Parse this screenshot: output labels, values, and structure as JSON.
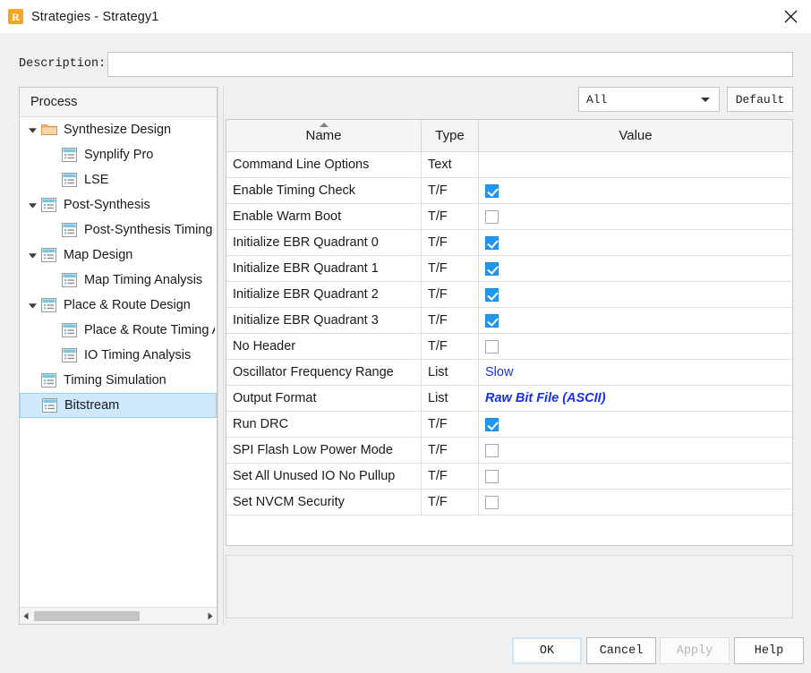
{
  "window": {
    "title": "Strategies - Strategy1",
    "icon": "app-r-icon",
    "close_icon": "close-icon"
  },
  "description": {
    "label": "Description:",
    "value": "",
    "placeholder": ""
  },
  "tree": {
    "header": "Process",
    "items": [
      {
        "label": "Synthesize Design",
        "indent": 0,
        "twisty": "expanded",
        "icon": "folder-icon",
        "selected": false
      },
      {
        "label": "Synplify Pro",
        "indent": 1,
        "twisty": "none",
        "icon": "document-icon",
        "selected": false
      },
      {
        "label": "LSE",
        "indent": 1,
        "twisty": "none",
        "icon": "document-icon",
        "selected": false
      },
      {
        "label": "Post-Synthesis",
        "indent": 0,
        "twisty": "expanded",
        "icon": "document-icon",
        "selected": false
      },
      {
        "label": "Post-Synthesis Timing Analysis",
        "indent": 1,
        "twisty": "none",
        "icon": "document-icon",
        "selected": false
      },
      {
        "label": "Map Design",
        "indent": 0,
        "twisty": "expanded",
        "icon": "document-icon",
        "selected": false
      },
      {
        "label": "Map Timing Analysis",
        "indent": 1,
        "twisty": "none",
        "icon": "document-icon",
        "selected": false
      },
      {
        "label": "Place & Route Design",
        "indent": 0,
        "twisty": "expanded",
        "icon": "document-icon",
        "selected": false
      },
      {
        "label": "Place & Route Timing Analysis",
        "indent": 1,
        "twisty": "none",
        "icon": "document-icon",
        "selected": false
      },
      {
        "label": "IO Timing Analysis",
        "indent": 1,
        "twisty": "none",
        "icon": "document-icon",
        "selected": false
      },
      {
        "label": "Timing Simulation",
        "indent": 0,
        "twisty": "none",
        "icon": "document-icon",
        "selected": false
      },
      {
        "label": "Bitstream",
        "indent": 0,
        "twisty": "none",
        "icon": "document-icon",
        "selected": true
      }
    ],
    "scrollbar": {
      "left_arrow": "triangle-left-icon",
      "right_arrow": "triangle-right-icon"
    }
  },
  "filter": {
    "selected": "All",
    "options": [
      "All"
    ],
    "caret_icon": "chevron-down-icon",
    "default_label": "Default"
  },
  "grid": {
    "columns": [
      "Name",
      "Type",
      "Value"
    ],
    "sort_column": "Name",
    "sort_direction": "ascending",
    "rows": [
      {
        "name": "Command Line Options",
        "type": "Text",
        "value_kind": "text",
        "value": ""
      },
      {
        "name": "Enable Timing Check",
        "type": "T/F",
        "value_kind": "checkbox",
        "checked": true
      },
      {
        "name": "Enable Warm Boot",
        "type": "T/F",
        "value_kind": "checkbox",
        "checked": false
      },
      {
        "name": "Initialize EBR Quadrant 0",
        "type": "T/F",
        "value_kind": "checkbox",
        "checked": true
      },
      {
        "name": "Initialize EBR Quadrant 1",
        "type": "T/F",
        "value_kind": "checkbox",
        "checked": true
      },
      {
        "name": "Initialize EBR Quadrant 2",
        "type": "T/F",
        "value_kind": "checkbox",
        "checked": true
      },
      {
        "name": "Initialize EBR Quadrant 3",
        "type": "T/F",
        "value_kind": "checkbox",
        "checked": true
      },
      {
        "name": "No Header",
        "type": "T/F",
        "value_kind": "checkbox",
        "checked": false
      },
      {
        "name": "Oscillator Frequency Range",
        "type": "List",
        "value_kind": "link",
        "value": "Slow",
        "emphasis": false
      },
      {
        "name": "Output Format",
        "type": "List",
        "value_kind": "link",
        "value": "Raw Bit File (ASCII)",
        "emphasis": true
      },
      {
        "name": "Run DRC",
        "type": "T/F",
        "value_kind": "checkbox",
        "checked": true
      },
      {
        "name": "SPI Flash Low Power Mode",
        "type": "T/F",
        "value_kind": "checkbox",
        "checked": false
      },
      {
        "name": "Set All Unused IO No Pullup",
        "type": "T/F",
        "value_kind": "checkbox",
        "checked": false
      },
      {
        "name": "Set NVCM Security",
        "type": "T/F",
        "value_kind": "checkbox",
        "checked": false
      }
    ]
  },
  "annotation": {
    "type": "hand-drawn-underline",
    "color": "#ee1111",
    "targets": "Raw Bit File (ASCII)"
  },
  "detail_panel": {
    "text": ""
  },
  "footer": {
    "buttons": [
      {
        "label": "OK",
        "state": "focused"
      },
      {
        "label": "Cancel",
        "state": "normal"
      },
      {
        "label": "Apply",
        "state": "disabled"
      },
      {
        "label": "Help",
        "state": "normal"
      }
    ]
  },
  "colors": {
    "accent_blue": "#2196f3",
    "link_blue": "#1730ee",
    "selection_blue": "#cfe8fb",
    "annotation_red": "#ee1111",
    "icon_orange": "#f5a623"
  }
}
